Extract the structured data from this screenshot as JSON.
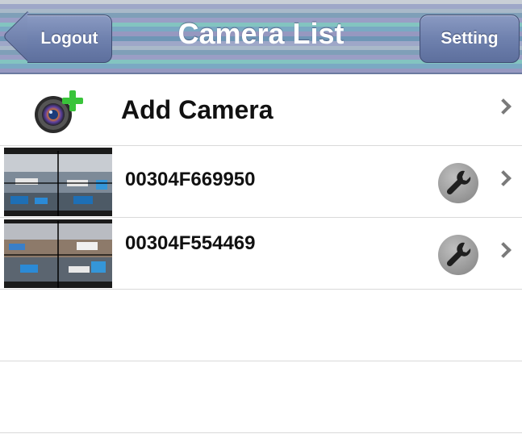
{
  "nav": {
    "title": "Camera List",
    "logout_label": "Logout",
    "setting_label": "Setting"
  },
  "add_camera": {
    "label": "Add Camera",
    "icon": "camera-add-icon"
  },
  "cameras": [
    {
      "id": "00304F669950",
      "thumbnail": "camera-snapshot",
      "action_icon": "wrench-icon"
    },
    {
      "id": "00304F554469",
      "thumbnail": "camera-snapshot",
      "action_icon": "wrench-icon"
    }
  ],
  "colors": {
    "nav_button": "#6f81ae",
    "accent_plus": "#39c43a",
    "separator": "#d9d9d9"
  }
}
